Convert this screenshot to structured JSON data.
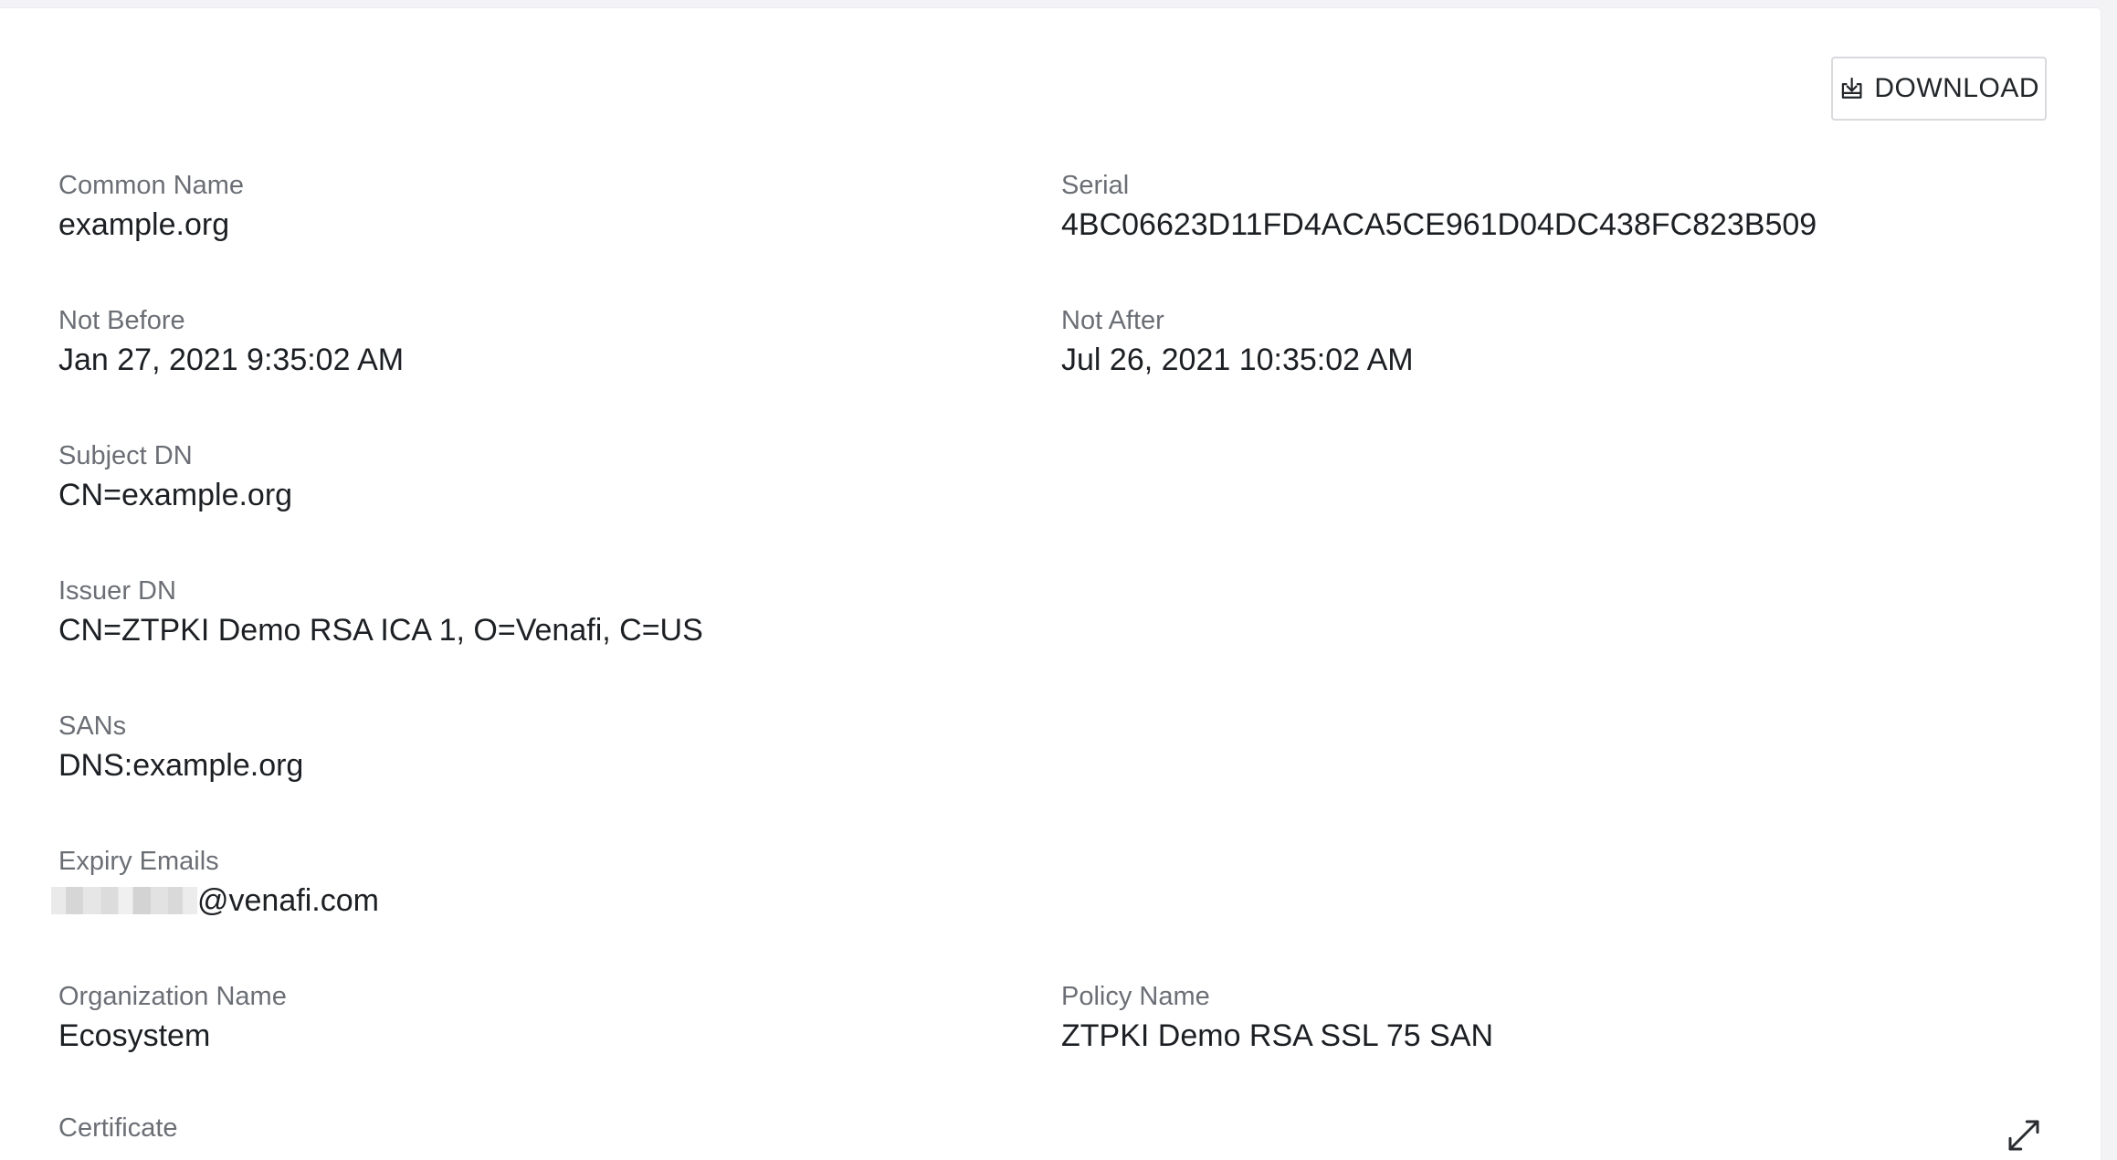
{
  "toolbar": {
    "download_label": "DOWNLOAD"
  },
  "fields": {
    "common_name": {
      "label": "Common Name",
      "value": "example.org"
    },
    "serial": {
      "label": "Serial",
      "value": "4BC06623D11FD4ACA5CE961D04DC438FC823B509"
    },
    "not_before": {
      "label": "Not Before",
      "value": "Jan 27, 2021 9:35:02 AM"
    },
    "not_after": {
      "label": "Not After",
      "value": "Jul 26, 2021 10:35:02 AM"
    },
    "subject_dn": {
      "label": "Subject DN",
      "value": "CN=example.org"
    },
    "issuer_dn": {
      "label": "Issuer DN",
      "value": "CN=ZTPKI Demo RSA ICA 1, O=Venafi, C=US"
    },
    "sans": {
      "label": "SANs",
      "value": "DNS:example.org"
    },
    "expiry_emails": {
      "label": "Expiry Emails",
      "value_suffix": "@venafi.com"
    },
    "organization_name": {
      "label": "Organization Name",
      "value": "Ecosystem"
    },
    "policy_name": {
      "label": "Policy Name",
      "value": "ZTPKI Demo RSA SSL 75 SAN"
    },
    "certificate": {
      "label": "Certificate"
    }
  },
  "icons": {
    "download": "download-icon",
    "expand": "expand-icon"
  }
}
